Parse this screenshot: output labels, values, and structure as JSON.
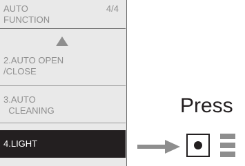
{
  "screen": {
    "header": {
      "title": "AUTO\nFUNCTION",
      "page_indicator": "4/4"
    },
    "scroll_up_icon": "up-triangle-icon",
    "items": [
      {
        "label": "2.AUTO OPEN\n/CLOSE"
      },
      {
        "label": "3.AUTO\n  CLEANING"
      },
      {
        "label": "4.LIGHT",
        "selected": true
      }
    ]
  },
  "instruction": {
    "label": "Press"
  },
  "controls": {
    "select_button_icon": "dot-button-icon",
    "menu_icon": "menu-lines-icon"
  },
  "colors": {
    "accent": "#231f20",
    "muted_text": "#8e8e8e",
    "screen_bg": "#e9e9e9"
  }
}
